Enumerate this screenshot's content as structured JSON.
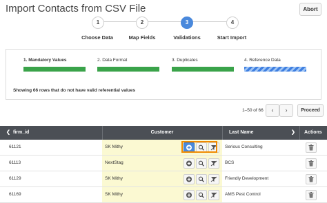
{
  "header": {
    "title": "Import Contacts from CSV File",
    "abort_label": "Abort"
  },
  "steps": [
    {
      "number": "1",
      "label": "Choose Data",
      "active": false
    },
    {
      "number": "2",
      "label": "Map Fields",
      "active": false
    },
    {
      "number": "3",
      "label": "Validations",
      "active": true
    },
    {
      "number": "4",
      "label": "Start Import",
      "active": false
    }
  ],
  "validations": {
    "categories": [
      {
        "label": "1. Mandatory Values",
        "status": "complete",
        "progress": 1.0
      },
      {
        "label": "2. Data Format",
        "status": "complete",
        "progress": 1.0
      },
      {
        "label": "3. Duplicates",
        "status": "complete",
        "progress": 1.0
      },
      {
        "label": "4. Reference Data",
        "status": "in-progress",
        "progress": 1.0
      }
    ],
    "message": "Showing 66 rows that do not have valid referential values"
  },
  "paging": {
    "range_text": "1–50 of 66",
    "prev_icon": "chevron-left-icon",
    "next_icon": "chevron-right-icon",
    "proceed_label": "Proceed"
  },
  "table": {
    "columns": [
      "firm_id",
      "Customer",
      "Last Name",
      "Actions"
    ],
    "rows": [
      {
        "firm_id": "61121",
        "customer": "SK Mithy",
        "last_name": "Serious Consulting"
      },
      {
        "firm_id": "61113",
        "customer": "NextStag",
        "last_name": "BCS"
      },
      {
        "firm_id": "61129",
        "customer": "SK Mithy",
        "last_name": "Friendly Development"
      },
      {
        "firm_id": "61169",
        "customer": "SK Mithy",
        "last_name": "AMS Pest Control"
      }
    ]
  },
  "colors": {
    "accent": "#4a89dc",
    "progress_green": "#3aa34a",
    "highlight_orange": "#f08a00",
    "customer_cell_bg": "#fbf9d2",
    "table_header_bg": "#4b4f55"
  },
  "icons": {
    "row_actions": [
      "plus-circle-icon",
      "search-icon",
      "no-filter-icon"
    ],
    "delete": "trash-icon"
  }
}
